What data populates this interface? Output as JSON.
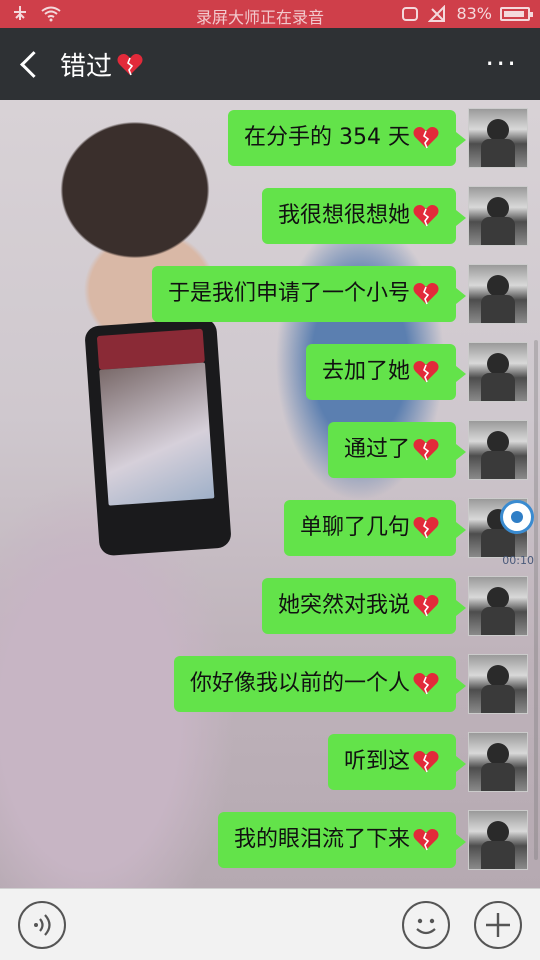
{
  "status_bar": {
    "center": "录屏大师正在录音",
    "battery": "83%"
  },
  "header": {
    "title": "错过",
    "more": "···"
  },
  "messages": [
    {
      "text": "在分手的 354 天"
    },
    {
      "text": "我很想很想她"
    },
    {
      "text": "于是我们申请了一个小号"
    },
    {
      "text": "去加了她"
    },
    {
      "text": "通过了"
    },
    {
      "text": "单聊了几句"
    },
    {
      "text": "她突然对我说"
    },
    {
      "text": "你好像我以前的一个人"
    },
    {
      "text": "听到这"
    },
    {
      "text": "我的眼泪流了下来"
    }
  ],
  "record_badge": {
    "time": "00:10"
  },
  "icons": {
    "heart": "broken-heart-icon",
    "voice": "voice-icon",
    "emoji": "emoji-icon",
    "plus": "plus-icon",
    "back": "back-arrow-icon"
  },
  "colors": {
    "bubble": "#63e34a",
    "titlebar": "#2e3134",
    "statusbar": "#cf3f4a"
  }
}
